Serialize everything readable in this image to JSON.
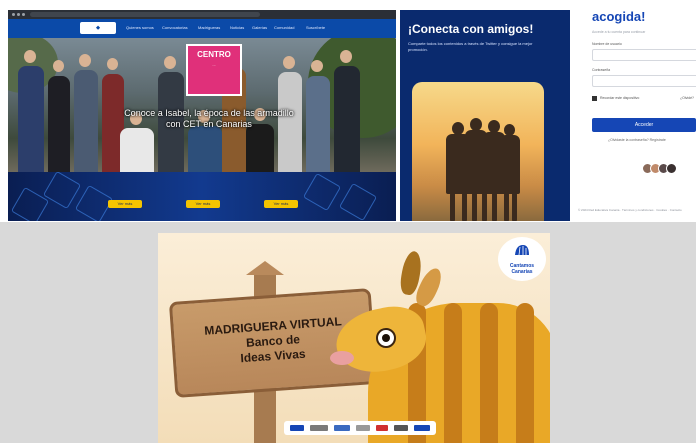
{
  "browser": {
    "nav": [
      "Quienes somos",
      "Convocatorias",
      "Madrigueras",
      "Noticias",
      "Galerías",
      "Comunidad",
      "Suscríbete"
    ],
    "badge": {
      "line1": "CENTRO",
      "line2": "..."
    },
    "caption": "Conoce a Isabel, la época de las armadillo con CET en Canarias",
    "band_buttons": [
      "Ver más",
      "Ver más",
      "Ver más"
    ]
  },
  "promo": {
    "title": "¡Conecta con amigos!",
    "description": "Comparte todos los contenidos a través de Twitter y consigue la mejor promoción."
  },
  "login": {
    "title": "acogida!",
    "subtitle": "Accede a tu cuenta para continuar",
    "user_label": "Nombre de usuario",
    "password_label": "Contraseña",
    "remember_label": "Recordar este dispositivo",
    "forgot_label": "¿Olvidé?",
    "submit_label": "Acceder",
    "lost_password": "¿Olvidaste la contraseña? Regístrate",
    "footer": "© 2024 Red Educativa Canaria · Términos y condiciones · Cookies · Contacto"
  },
  "banner": {
    "line1": "MADRIGUERA VIRTUAL",
    "line2": "Banco de",
    "line3": "Ideas Vivas",
    "logo": "Cantamos Canarias"
  },
  "colors": {
    "brand_blue": "#1546b5",
    "promo_bg": "#0a2a6e",
    "accent_yellow": "#f4c400"
  }
}
